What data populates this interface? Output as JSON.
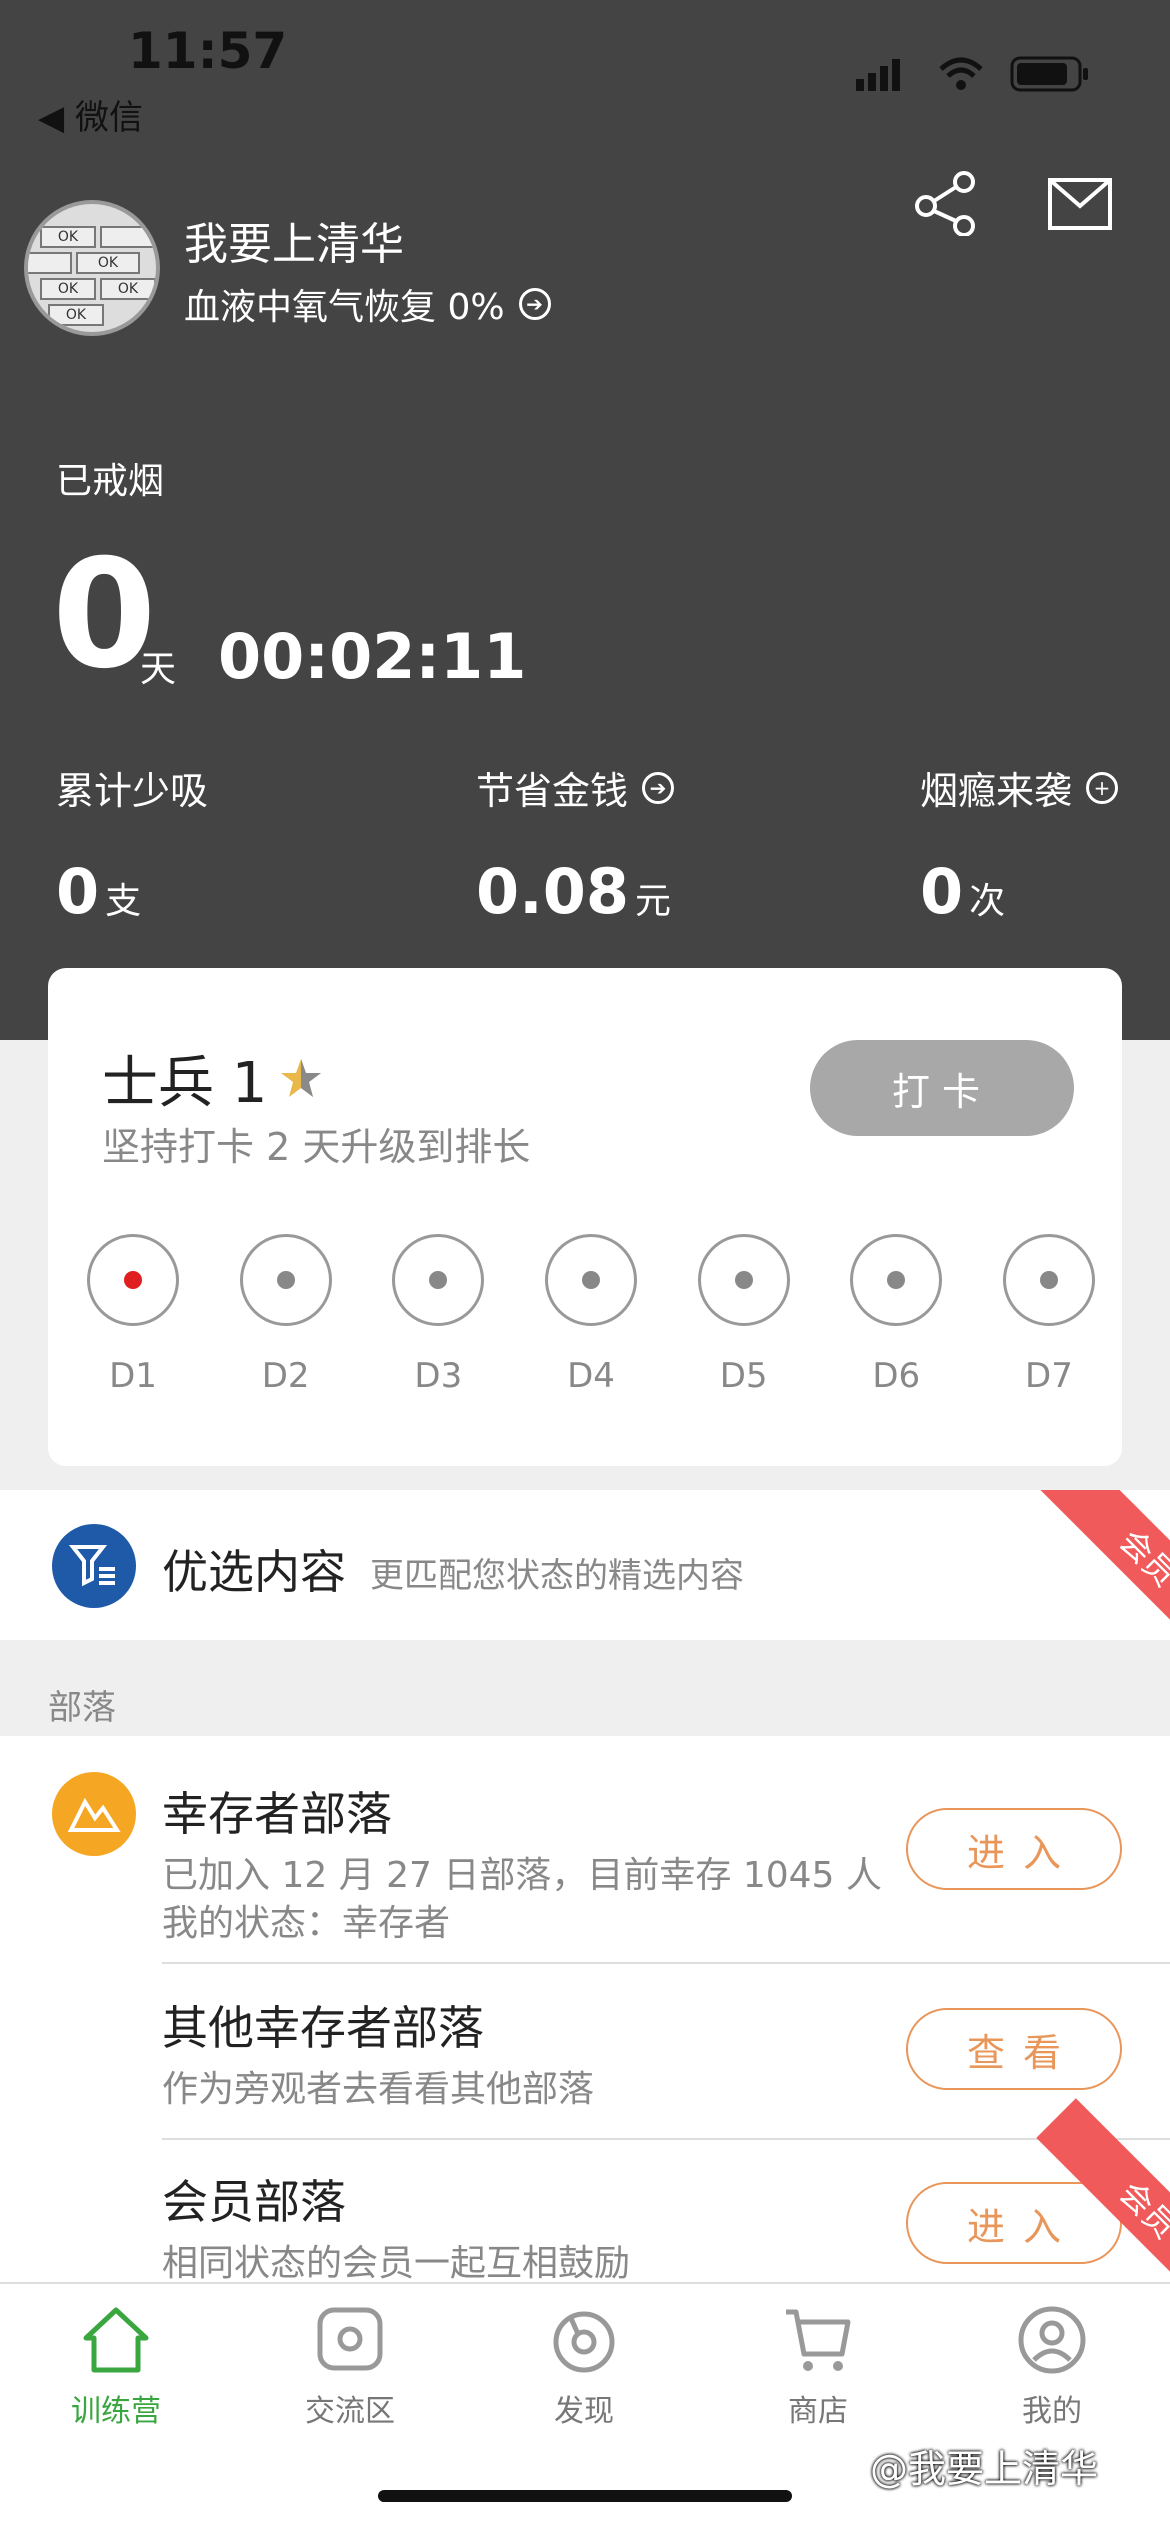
{
  "status_bar": {
    "time": "11:57",
    "back_label": "◀ 微信"
  },
  "profile": {
    "nickname": "我要上清华",
    "oxygen_text": "血液中氧气恢复 0%"
  },
  "quit": {
    "label": "已戒烟",
    "days": "0",
    "day_unit": "天",
    "timer": "00:02:11"
  },
  "stats": [
    {
      "label": "累计少吸",
      "value": "0",
      "unit": "支"
    },
    {
      "label": "节省金钱",
      "value": "0.08",
      "unit": "元"
    },
    {
      "label": "烟瘾来袭",
      "value": "0",
      "unit": "次"
    }
  ],
  "rank_card": {
    "rank": "士兵 1",
    "subtitle": "坚持打卡 2 天升级到排长",
    "checkin_label": "打卡",
    "days": [
      "D1",
      "D2",
      "D3",
      "D4",
      "D5",
      "D6",
      "D7"
    ],
    "active_day_index": 0
  },
  "featured": {
    "title": "优选内容",
    "subtitle": "更匹配您状态的精选内容",
    "badge": "会员"
  },
  "tribes": {
    "header": "部落",
    "items": [
      {
        "title": "幸存者部落",
        "line1": "已加入 12 月 27 日部落，目前幸存 1045 人",
        "line2": "我的状态：幸存者",
        "button": "进入"
      },
      {
        "title": "其他幸存者部落",
        "line1": "作为旁观者去看看其他部落",
        "button": "查看"
      },
      {
        "title": "会员部落",
        "line1": "相同状态的会员一起互相鼓励",
        "button": "进入",
        "badge": "会员"
      }
    ]
  },
  "tabbar": {
    "tabs": [
      {
        "label": "训练营",
        "icon": "home-icon",
        "active": true
      },
      {
        "label": "交流区",
        "icon": "chat-icon"
      },
      {
        "label": "发现",
        "icon": "compass-icon"
      },
      {
        "label": "商店",
        "icon": "cart-icon"
      },
      {
        "label": "我的",
        "icon": "user-icon"
      }
    ]
  },
  "watermark": "@我要上清华",
  "colors": {
    "header_bg": "#444444",
    "accent_green": "#3aa640",
    "button_orange": "#e8965a",
    "ribbon_red": "#f05a5a"
  }
}
